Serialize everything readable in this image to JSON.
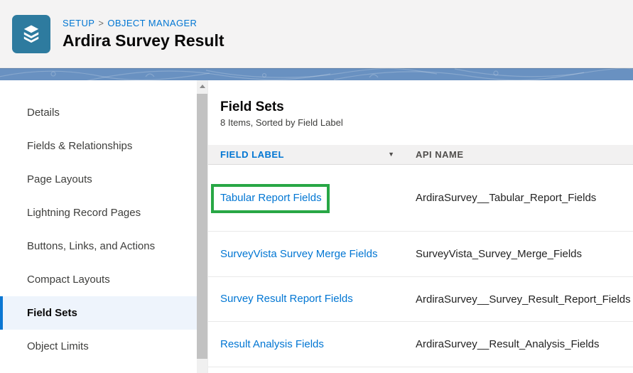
{
  "header": {
    "breadcrumb": {
      "setup": "SETUP",
      "separator": ">",
      "object_manager": "OBJECT MANAGER"
    },
    "title": "Ardira Survey Result"
  },
  "sidebar": {
    "items": [
      {
        "label": "Details",
        "selected": false
      },
      {
        "label": "Fields & Relationships",
        "selected": false
      },
      {
        "label": "Page Layouts",
        "selected": false
      },
      {
        "label": "Lightning Record Pages",
        "selected": false
      },
      {
        "label": "Buttons, Links, and Actions",
        "selected": false
      },
      {
        "label": "Compact Layouts",
        "selected": false
      },
      {
        "label": "Field Sets",
        "selected": true
      },
      {
        "label": "Object Limits",
        "selected": false
      }
    ]
  },
  "main": {
    "heading": "Field Sets",
    "subtitle": "8 Items, Sorted by Field Label",
    "table": {
      "columns": [
        {
          "label": "FIELD LABEL",
          "sorted": "desc"
        },
        {
          "label": "API NAME",
          "sorted": "none"
        }
      ],
      "sort_indicator": "▼",
      "rows": [
        {
          "field_label": "Tabular Report Fields",
          "api_name": "ArdiraSurvey__Tabular_Report_Fields",
          "annotated": true
        },
        {
          "field_label": "SurveyVista Survey Merge Fields",
          "api_name": "SurveyVista_Survey_Merge_Fields",
          "annotated": false
        },
        {
          "field_label": "Survey Result Report Fields",
          "api_name": "ArdiraSurvey__Survey_Result_Report_Fields",
          "annotated": false
        },
        {
          "field_label": "Result Analysis Fields",
          "api_name": "ArdiraSurvey__Result_Analysis_Fields",
          "annotated": false
        }
      ]
    }
  },
  "icons": {
    "object_manager": "layers-icon",
    "sort_desc": "▼",
    "scroll_up": "▲"
  },
  "colors": {
    "accent_blue": "#0176d3",
    "icon_background": "#2e7b9f",
    "brand_band": "#6991c1",
    "selected_item_background": "#eef4fc",
    "annotation_green": "#28a745",
    "header_background": "#f4f3f3",
    "table_header_background": "#f2f1f1"
  }
}
